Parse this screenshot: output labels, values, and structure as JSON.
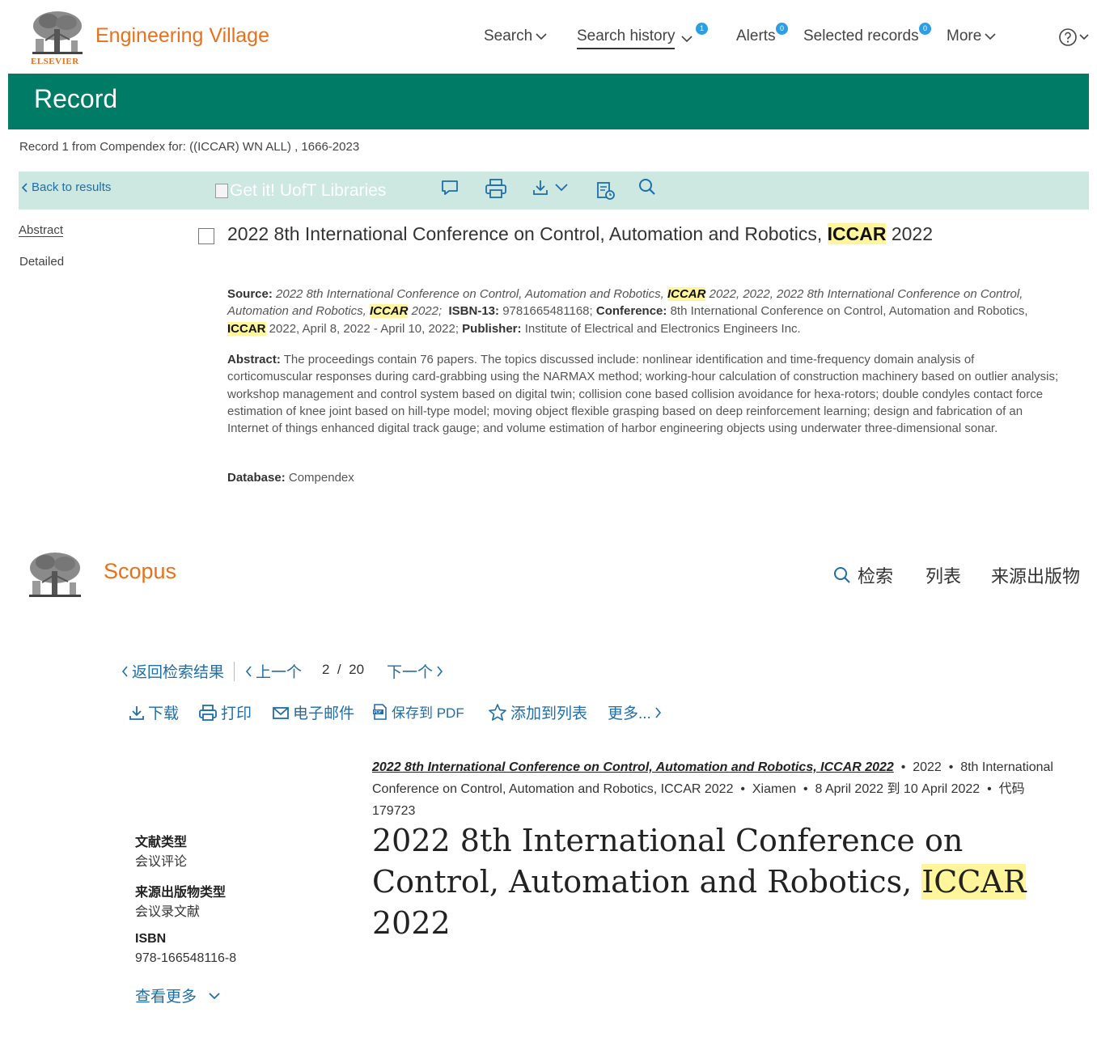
{
  "ev": {
    "logo_text": "ELSEVIER",
    "brand": "Engineering Village",
    "nav": {
      "search": "Search",
      "search_history": "Search history",
      "search_history_badge": "1",
      "alerts": "Alerts",
      "alerts_badge": "0",
      "selected_records": "Selected records",
      "selected_records_badge": "0",
      "more": "More"
    },
    "banner_title": "Record",
    "record_line": "Record 1 from Compendex for: ((ICCAR) WN ALL) , 1666-2023",
    "toolbar": {
      "back": "Back to results",
      "getit": "Get it! UofT Libraries"
    },
    "sidebar": {
      "abstract": "Abstract",
      "detailed": "Detailed"
    },
    "record": {
      "title_pre": "2022 8th International Conference on Control, Automation and Robotics, ",
      "title_hl": "ICCAR",
      "title_post": " 2022",
      "source_label": "Source:",
      "source_italic_a": "2022 8th International Conference on Control, Automation and Robotics, ",
      "source_hl_a": "ICCAR",
      "source_italic_b": " 2022, 2022, 2022 8th International Conference on Control, Automation and Robotics, ",
      "source_hl_b": "ICCAR",
      "source_italic_c": " 2022;",
      "isbn_label": "ISBN-13:",
      "isbn_value": "9781665481168;",
      "conference_label": "Conference:",
      "conference_value": "8th International Conference on Control, Automation and Robotics, ",
      "conference_hl": "ICCAR",
      "conference_dates": " 2022, April 8, 2022 - April 10, 2022;",
      "publisher_label": "Publisher:",
      "publisher_value": "Institute of Electrical and Electronics Engineers Inc.",
      "abstract_label": "Abstract:",
      "abstract_text": "The proceedings contain 76 papers. The topics discussed include: nonlinear identification and time-frequency domain analysis of corticomuscular responses during card-grabbing using the NARMAX method; working-hour calculation of construction machinery based on outlier analysis; workshop management and control system based on digital twin; collision cone based collision avoidance for hexa-rotors; double condyles contact force estimation of knee joint based on hill-type model; moving object flexible grasping based on deep reinforcement learning; design and fabrication of an Internet of things enhanced digital track gauge; and volume estimation of harbor engineering objects using underwater three-dimensional sonar.",
      "database_label": "Database:",
      "database_value": "Compendex"
    }
  },
  "scopus": {
    "brand": "Scopus",
    "nav": {
      "search": "检索",
      "lists": "列表",
      "sources": "来源出版物"
    },
    "pager": {
      "back": "返回检索结果",
      "prev": "上一个",
      "current": "2",
      "slash": "/",
      "total": "20",
      "next": "下一个"
    },
    "actions": {
      "download": "下载",
      "print": "打印",
      "email": "电子邮件",
      "save_pdf": "保存到 PDF",
      "add_list": "添加到列表",
      "more": "更多..."
    },
    "source": {
      "link": "2022 8th International Conference on Control, Automation and Robotics, ICCAR 2022",
      "year": "2022",
      "conf": "8th International Conference on Control, Automation and Robotics, ICCAR 2022",
      "place": "Xiamen",
      "dates": "8 April 2022 到 10 April 2022",
      "code": "代码 179723",
      "bullet": "•"
    },
    "side": {
      "doc_type_label": "文献类型",
      "doc_type_value": "会议评论",
      "source_type_label": "来源出版物类型",
      "source_type_value": "会议录文献",
      "isbn_label": "ISBN",
      "isbn_value": "978-166548116-8",
      "show_more": "查看更多"
    },
    "title_pre": "2022 8th International Conference on Control, Automation and Robotics, ",
    "title_hl": "ICCAR",
    "title_post": " 2022"
  },
  "colors": {
    "elsevier_orange": "#e9711c",
    "ev_green": "#007b65",
    "toolbar_mint": "#cde7e1",
    "link_blue": "#1f6ea8",
    "badge_blue": "#2d9de5",
    "highlight_yellow": "#fff59a"
  }
}
